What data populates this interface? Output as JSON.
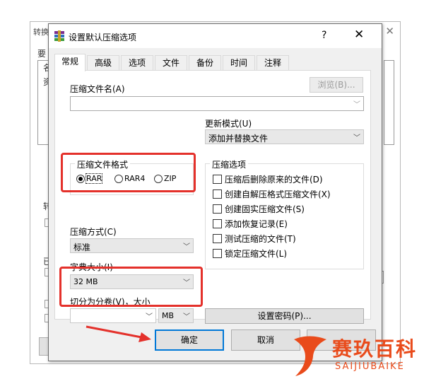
{
  "background_window": {
    "title": "转换",
    "fragments": [
      "要",
      "名",
      "资",
      "转",
      "已"
    ]
  },
  "dialog": {
    "title": "设置默认压缩选项",
    "help": "?",
    "close": "✕",
    "tabs": [
      {
        "label": "常规",
        "active": true
      },
      {
        "label": "高级",
        "active": false
      },
      {
        "label": "选项",
        "active": false
      },
      {
        "label": "文件",
        "active": false
      },
      {
        "label": "备份",
        "active": false
      },
      {
        "label": "时间",
        "active": false
      },
      {
        "label": "注释",
        "active": false
      }
    ],
    "archive_name": {
      "label": "压缩文件名(A)",
      "value": "",
      "browse_label": "浏览(B)..."
    },
    "update_mode": {
      "label": "更新模式(U)",
      "value": "添加并替换文件"
    },
    "format": {
      "title": "压缩文件格式",
      "options": [
        {
          "label": "RAR",
          "selected": true
        },
        {
          "label": "RAR4",
          "selected": false
        },
        {
          "label": "ZIP",
          "selected": false
        }
      ]
    },
    "compression_options": {
      "title": "压缩选项",
      "items": [
        "压缩后删除原来的文件(D)",
        "创建自解压格式压缩文件(X)",
        "创建固实压缩文件(S)",
        "添加恢复记录(E)",
        "测试压缩的文件(T)",
        "锁定压缩文件(L)"
      ]
    },
    "method": {
      "label": "压缩方式(C)",
      "value": "标准"
    },
    "dictionary": {
      "label": "字典大小(I)",
      "value": "32 MB"
    },
    "split": {
      "label": "切分为分卷(V)，大小",
      "value": "",
      "unit": "MB"
    },
    "set_password_label": "设置密码(P)...",
    "ok_label": "确定",
    "cancel_label": "取消"
  },
  "watermark": {
    "name": "赛玖百科",
    "sub": "SAIJIUBAIKE"
  },
  "colors": {
    "highlight": "#e4312b",
    "watermark": "#e94b1b",
    "accent": "#0078d7"
  }
}
